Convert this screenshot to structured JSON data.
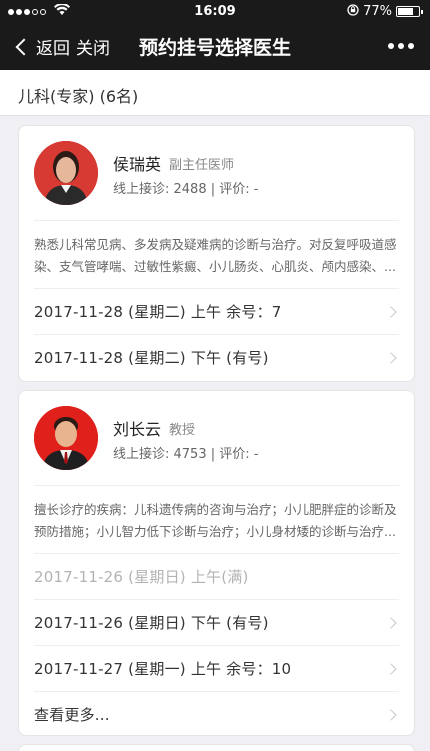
{
  "status_bar": {
    "time": "16:09",
    "battery": "77%",
    "battery_level": 0.77
  },
  "nav": {
    "back_label": "返回",
    "close_label": "关闭",
    "title": "预约挂号选择医生"
  },
  "dept": {
    "label": "儿科(专家) (6名)"
  },
  "doctors": [
    {
      "name": "侯瑞英",
      "title": "副主任医师",
      "stats": "线上接诊: 2488 | 评价: -",
      "description": "熟悉儿科常见病、多发病及疑难病的诊断与治疗。对反复呼吸道感染、支气管哮喘、过敏性紫癜、小儿肠炎、心肌炎、颅内感染、...",
      "slots": [
        {
          "text": "2017-11-28 (星期二)  上午  余号：7"
        },
        {
          "text": "2017-11-28 (星期二)  下午  (有号)"
        }
      ]
    },
    {
      "name": "刘长云",
      "title": "教授",
      "stats": "线上接诊: 4753 | 评价: -",
      "description": "擅长诊疗的疾病：儿科遗传病的咨询与治疗；小儿肥胖症的诊断及预防措施；小儿智力低下诊断与治疗；小儿身材矮的诊断与治疗...",
      "slots": [
        {
          "text": "2017-11-26 (星期日)  上午(满)"
        },
        {
          "text": "2017-11-26 (星期日)  下午  (有号)"
        },
        {
          "text": "2017-11-27 (星期一)  上午  余号：10"
        }
      ],
      "more_label": "查看更多..."
    }
  ]
}
